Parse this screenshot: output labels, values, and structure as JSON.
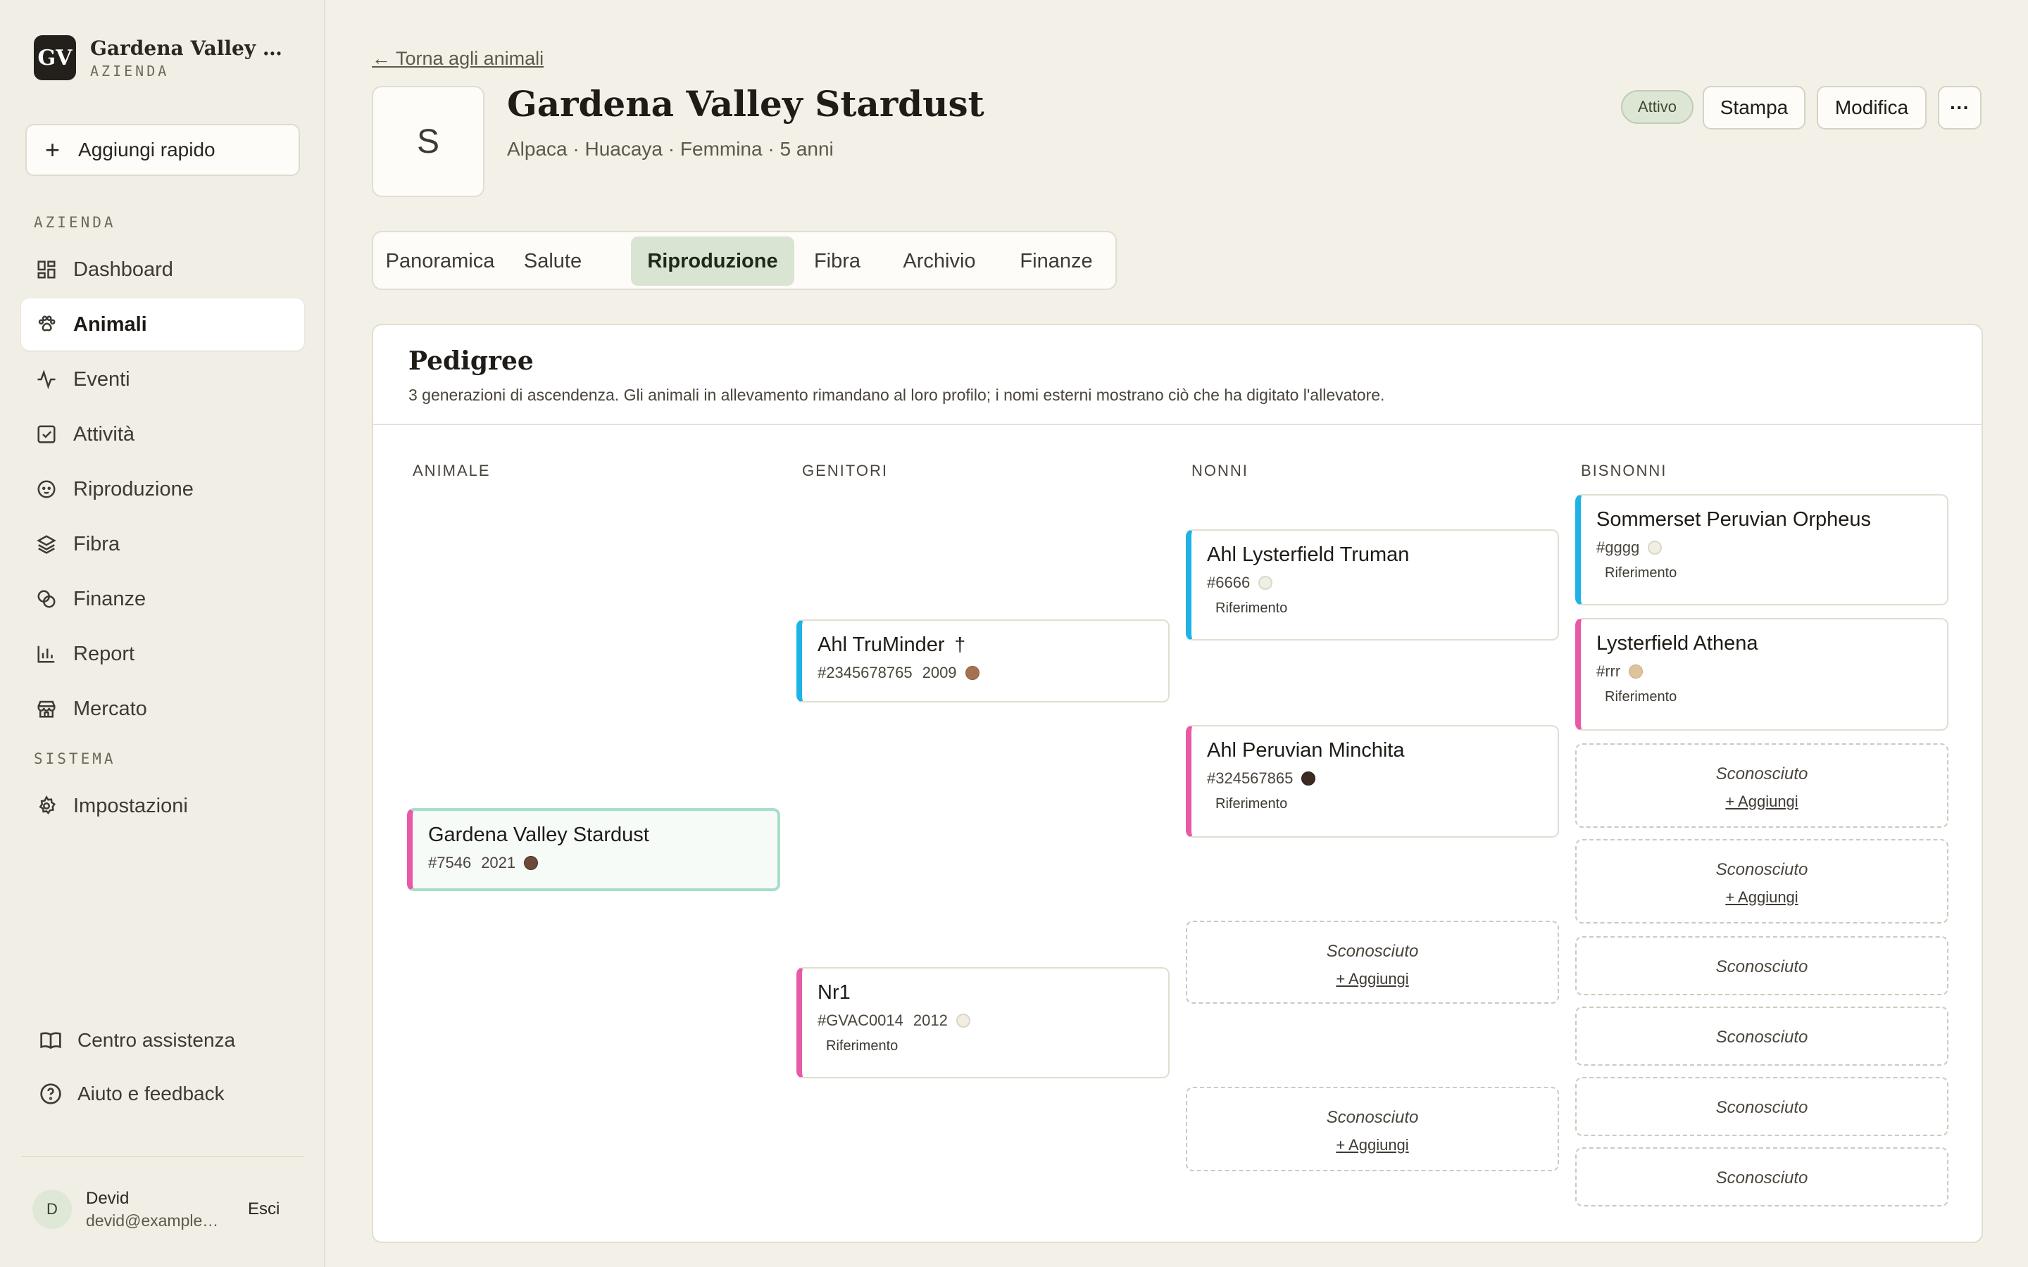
{
  "brand": {
    "initials": "GV",
    "name": "Gardena Valley Alpacas",
    "subtitle": "AZIENDA"
  },
  "sidebar": {
    "quick_add": "Aggiungi rapido",
    "section_azienda": "AZIENDA",
    "section_sistema": "SISTEMA",
    "items": [
      {
        "label": "Dashboard",
        "icon": "dashboard-icon"
      },
      {
        "label": "Animali",
        "icon": "paw-icon",
        "active": true
      },
      {
        "label": "Eventi",
        "icon": "activity-icon"
      },
      {
        "label": "Attività",
        "icon": "checkbox-icon"
      },
      {
        "label": "Riproduzione",
        "icon": "baby-icon"
      },
      {
        "label": "Fibra",
        "icon": "layers-icon"
      },
      {
        "label": "Finanze",
        "icon": "coins-icon"
      },
      {
        "label": "Report",
        "icon": "bar-chart-icon"
      },
      {
        "label": "Mercato",
        "icon": "store-icon"
      }
    ],
    "settings": "Impostazioni",
    "help_center": "Centro assistenza",
    "feedback": "Aiuto e feedback"
  },
  "user": {
    "initial": "D",
    "name": "Devid",
    "email": "devid@example.com",
    "logout": "Esci"
  },
  "header": {
    "back": "← Torna agli animali",
    "avatar_letter": "S",
    "title": "Gardena Valley Stardust",
    "subtitle": "Alpaca · Huacaya · Femmina · 5 anni",
    "status": "Attivo",
    "print": "Stampa",
    "edit": "Modifica",
    "more": "···"
  },
  "tabs": [
    "Panoramica",
    "Salute",
    "Riproduzione",
    "Fibra",
    "Archivio",
    "Finanze"
  ],
  "active_tab": "Riproduzione",
  "pedigree": {
    "title": "Pedigree",
    "description": "3 generazioni di ascendenza. Gli animali in allevamento rimandano al loro profilo; i nomi esterni mostrano ciò che ha digitato l'allevatore.",
    "columns": [
      "ANIMALE",
      "GENITORI",
      "NONNI",
      "BISNONNI"
    ],
    "unknown": "Sconosciuto",
    "add": "+ Aggiungi",
    "ref": "Riferimento",
    "self": {
      "name": "Gardena Valley Stardust",
      "id": "#7546",
      "year": "2021",
      "color": "#6b4a3a"
    },
    "sire": {
      "name": "Ahl TruMinder",
      "id": "#2345678765",
      "year": "2009",
      "color": "#a7714f",
      "deceased": "†"
    },
    "dam": {
      "name": "Nr1",
      "id": "#GVAC0014",
      "year": "2012",
      "color": "#f2ece2"
    },
    "sire_sire": {
      "name": "Ahl Lysterfield Truman",
      "id": "#6666",
      "color": "#eef0e4"
    },
    "sire_dam": {
      "name": "Ahl Peruvian Minchita",
      "id": "#324567865",
      "color": "#3d2a22"
    },
    "ss_sire": {
      "name": "Sommerset Peruvian Orpheus",
      "id": "#gggg",
      "color": "#f1efe4"
    },
    "ss_dam": {
      "name": "Lysterfield Athena",
      "id": "#rrr",
      "color": "#dfc39a"
    }
  }
}
